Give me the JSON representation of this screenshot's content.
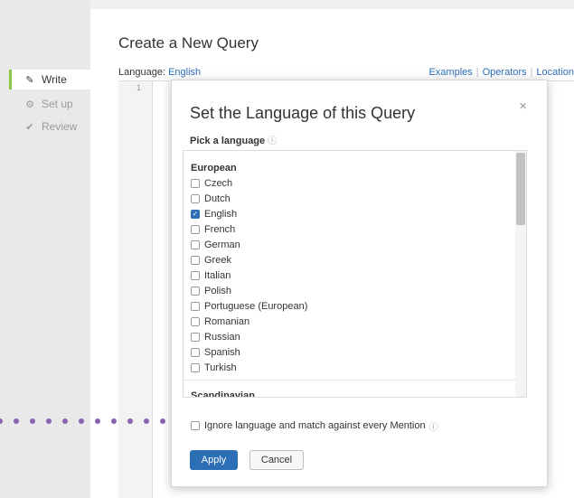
{
  "sidebar": {
    "items": [
      {
        "label": "Write",
        "icon": "pencil-icon"
      },
      {
        "label": "Set up",
        "icon": "gear-icon"
      },
      {
        "label": "Review",
        "icon": "check-icon"
      }
    ]
  },
  "main": {
    "title": "Create a New Query",
    "language_label": "Language:",
    "language_value": "English",
    "links": [
      "Examples",
      "Operators",
      "Location"
    ],
    "line_number": "1"
  },
  "modal": {
    "title": "Set the Language of this Query",
    "close": "×",
    "pick_label": "Pick a language",
    "help_icon": "ⓘ",
    "groups": [
      {
        "name": "European",
        "languages": [
          {
            "label": "Czech",
            "checked": false
          },
          {
            "label": "Dutch",
            "checked": false
          },
          {
            "label": "English",
            "checked": true
          },
          {
            "label": "French",
            "checked": false
          },
          {
            "label": "German",
            "checked": false
          },
          {
            "label": "Greek",
            "checked": false
          },
          {
            "label": "Italian",
            "checked": false
          },
          {
            "label": "Polish",
            "checked": false
          },
          {
            "label": "Portuguese (European)",
            "checked": false
          },
          {
            "label": "Romanian",
            "checked": false
          },
          {
            "label": "Russian",
            "checked": false
          },
          {
            "label": "Spanish",
            "checked": false
          },
          {
            "label": "Turkish",
            "checked": false
          }
        ]
      },
      {
        "name": "Scandinavian",
        "languages": []
      }
    ],
    "ignore_label": "Ignore language and match against every Mention",
    "apply_label": "Apply",
    "cancel_label": "Cancel"
  },
  "colors": {
    "accent": "#2d6fb6",
    "active_marker": "#8dc63f",
    "annotation_dots": "#8a63b0"
  }
}
